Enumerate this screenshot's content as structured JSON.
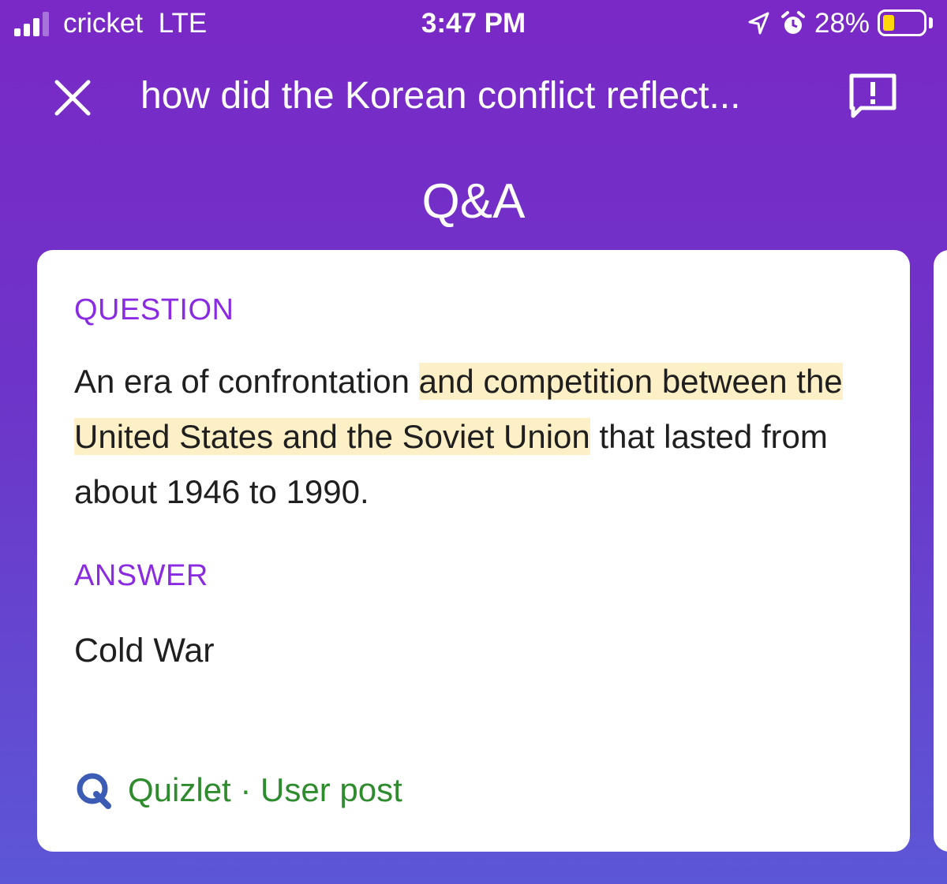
{
  "status_bar": {
    "carrier": "cricket",
    "network": "LTE",
    "time": "3:47 PM",
    "battery_percent": "28%",
    "battery_level": 0.28,
    "signal_bars_active": 3,
    "signal_bars_total": 4
  },
  "header": {
    "title": "how did the Korean conflict reflect..."
  },
  "page": {
    "title": "Q&A"
  },
  "card": {
    "question_label": "QUESTION",
    "question_parts": {
      "plain_start": "An era of confrontation ",
      "highlighted": "and competition between the United States and the Soviet Union",
      "plain_end": " that lasted from about 1946 to 1990."
    },
    "answer_label": "ANSWER",
    "answer": "Cold War",
    "source": {
      "text": "Quizlet · User post",
      "icon": "quizlet-q-icon"
    }
  },
  "colors": {
    "background_top": "#7a28c6",
    "background_bottom": "#5c57d6",
    "label": "#8a2be2",
    "highlight": "#fdefc6",
    "source": "#2e8b2e",
    "battery": "#ffd60a"
  }
}
